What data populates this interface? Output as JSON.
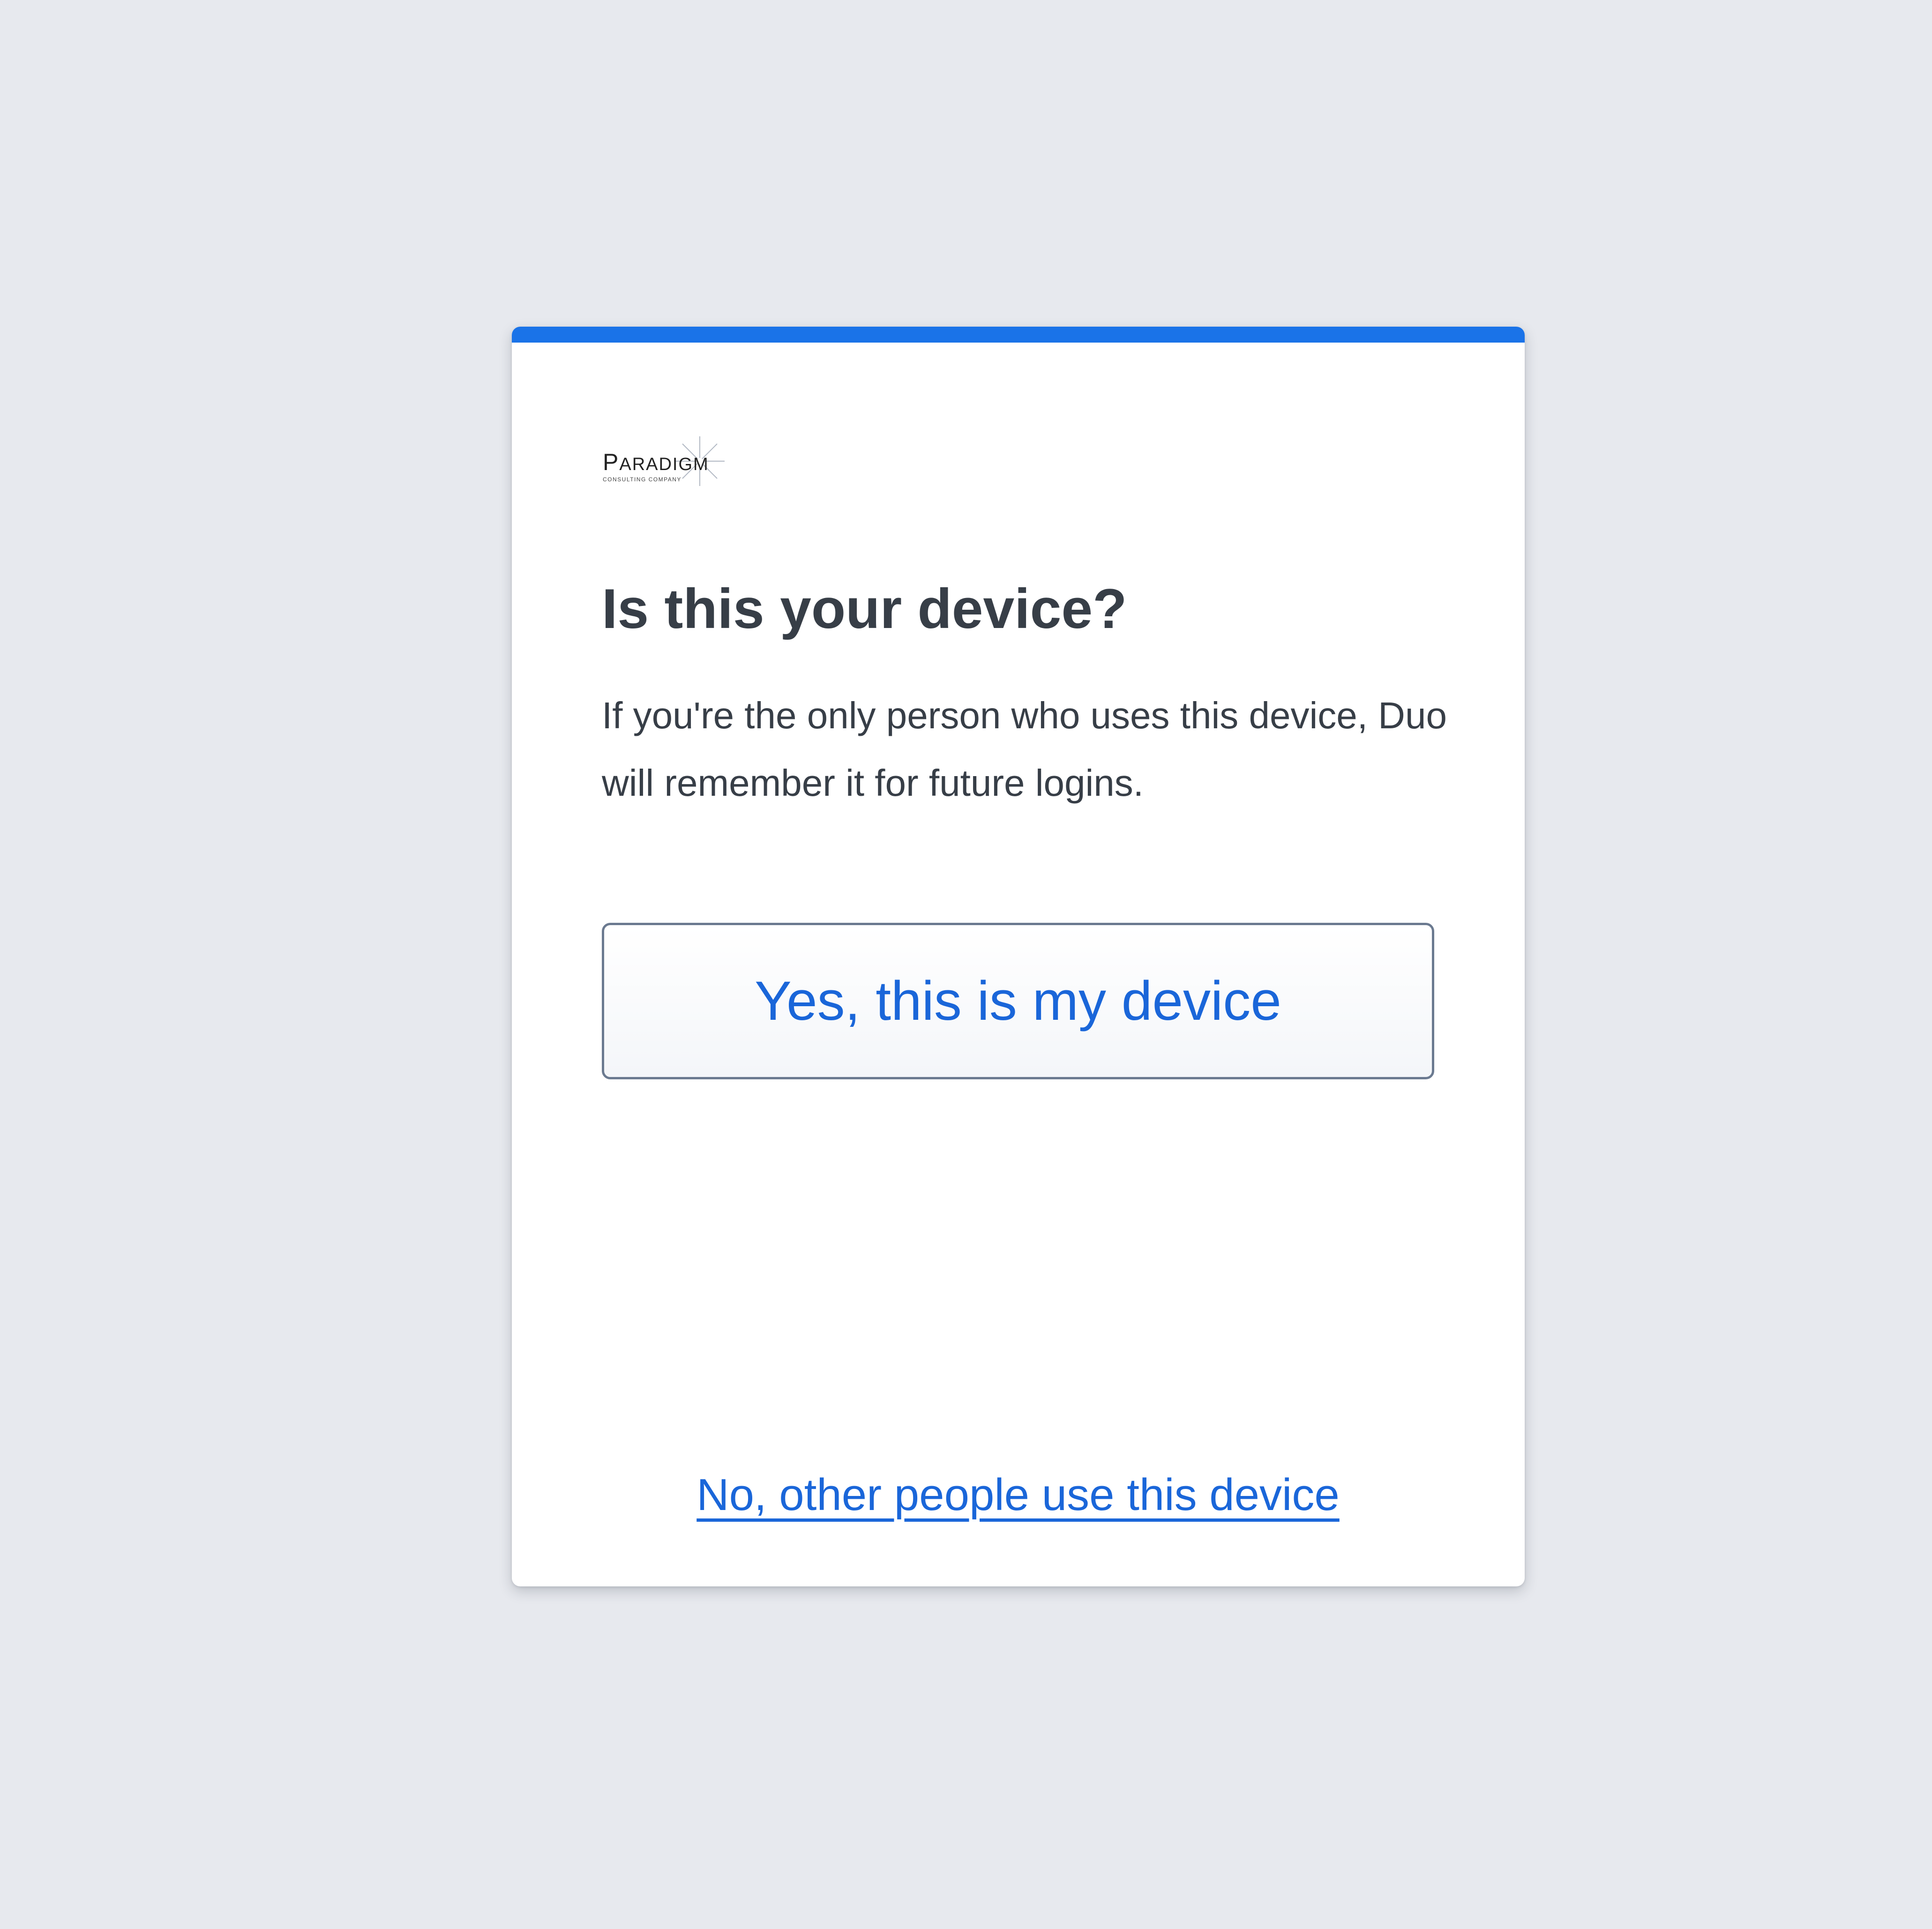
{
  "colors": {
    "background": "#e7e9ee",
    "card": "#ffffff",
    "accent": "#1a73e8",
    "heading_text": "#373e47",
    "link_text": "#1a66d9",
    "button_border": "#6b7a90"
  },
  "logo": {
    "icon": "paradigm-logo",
    "name": "PARADIGM",
    "tagline": "CONSULTING COMPANY"
  },
  "prompt": {
    "heading": "Is this your device?",
    "description": "If you're the only person who uses this device, Duo will remember it for future logins."
  },
  "actions": {
    "yes_label": "Yes, this is my device",
    "no_label": "No, other people use this device"
  }
}
